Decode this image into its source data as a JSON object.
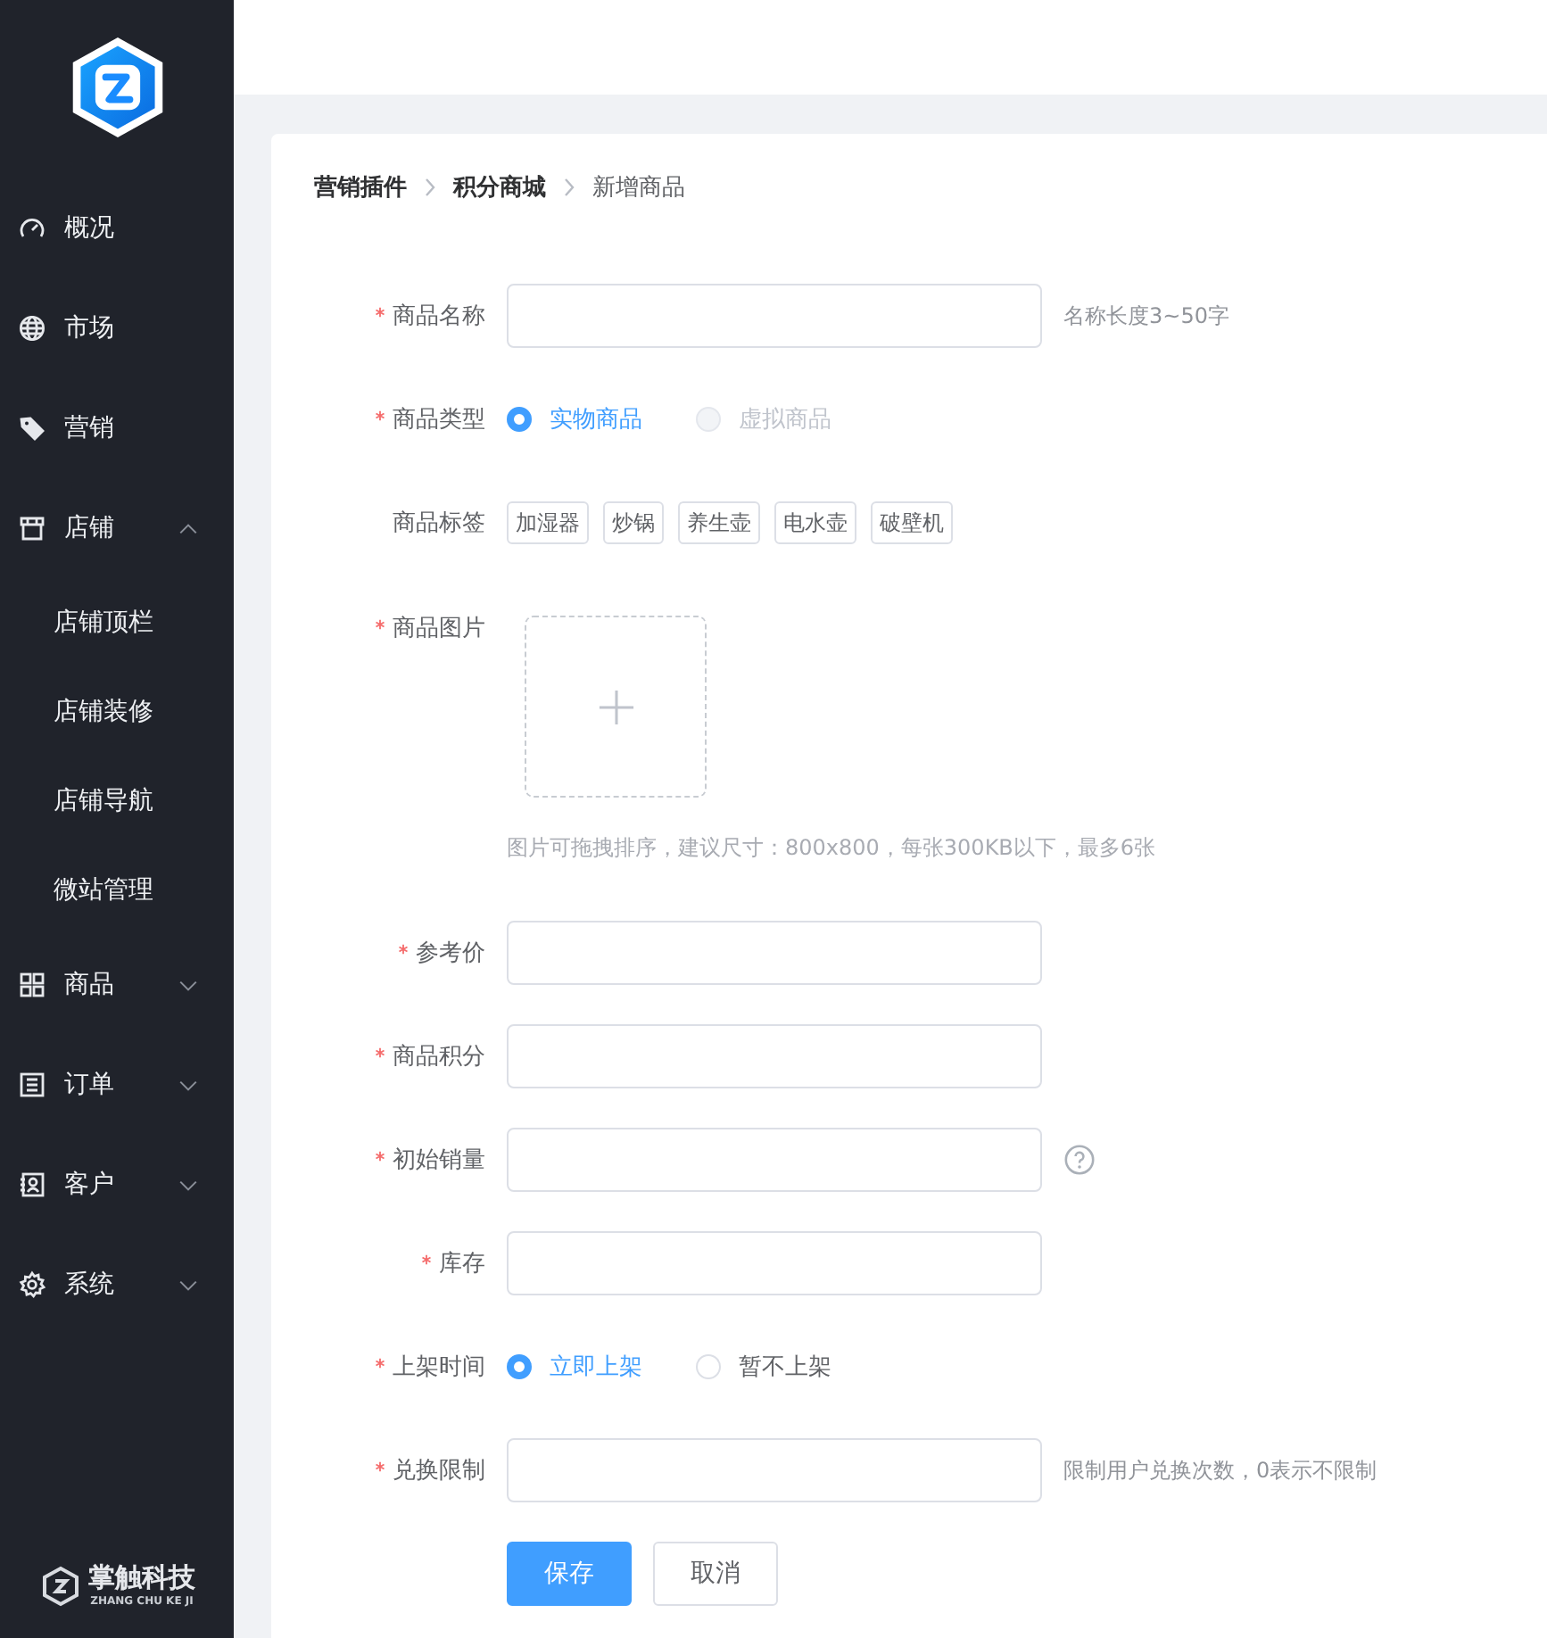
{
  "sidebar": {
    "brand": {
      "name": "掌触科技",
      "pinyin": "ZHANG CHU KE JI"
    },
    "items": [
      {
        "label": "概况"
      },
      {
        "label": "市场"
      },
      {
        "label": "营销"
      },
      {
        "label": "店铺",
        "expanded": true,
        "children": [
          {
            "label": "店铺顶栏"
          },
          {
            "label": "店铺装修"
          },
          {
            "label": "店铺导航"
          },
          {
            "label": "微站管理"
          }
        ]
      },
      {
        "label": "商品",
        "expanded": false
      },
      {
        "label": "订单",
        "expanded": false
      },
      {
        "label": "客户",
        "expanded": false
      },
      {
        "label": "系统",
        "expanded": false
      }
    ]
  },
  "breadcrumb": [
    {
      "label": "营销插件",
      "current": false
    },
    {
      "label": "积分商城",
      "current": false
    },
    {
      "label": "新增商品",
      "current": true
    }
  ],
  "form": {
    "fields": [
      {
        "kind": "input",
        "label": "商品名称",
        "required": true,
        "hint": "名称长度3~50字"
      },
      {
        "kind": "radio",
        "label": "商品类型",
        "required": true,
        "options": [
          {
            "label": "实物商品",
            "selected": true,
            "disabled": false
          },
          {
            "label": "虚拟商品",
            "selected": false,
            "disabled": true
          }
        ]
      },
      {
        "kind": "tags",
        "label": "商品标签",
        "tags": [
          "加湿器",
          "炒锅",
          "养生壶",
          "电水壶",
          "破壁机"
        ]
      },
      {
        "kind": "upload",
        "label": "商品图片",
        "required": true,
        "hint": "图片可拖拽排序，建议尺寸：800x800，每张300KB以下，最多6张"
      },
      {
        "kind": "input",
        "label": "参考价",
        "required": true
      },
      {
        "kind": "input",
        "label": "商品积分",
        "required": true
      },
      {
        "kind": "input",
        "label": "初始销量",
        "required": true,
        "help": true
      },
      {
        "kind": "input",
        "label": "库存",
        "required": true
      },
      {
        "kind": "radio",
        "label": "上架时间",
        "required": true,
        "options": [
          {
            "label": "立即上架",
            "selected": true,
            "disabled": false
          },
          {
            "label": "暂不上架",
            "selected": false,
            "disabled": false
          }
        ]
      },
      {
        "kind": "input",
        "label": "兑换限制",
        "required": true,
        "hint": "限制用户兑换次数，0表示不限制"
      }
    ],
    "buttons": [
      {
        "label": "保存",
        "kind": "primary"
      },
      {
        "label": "取消",
        "kind": "default"
      }
    ]
  }
}
